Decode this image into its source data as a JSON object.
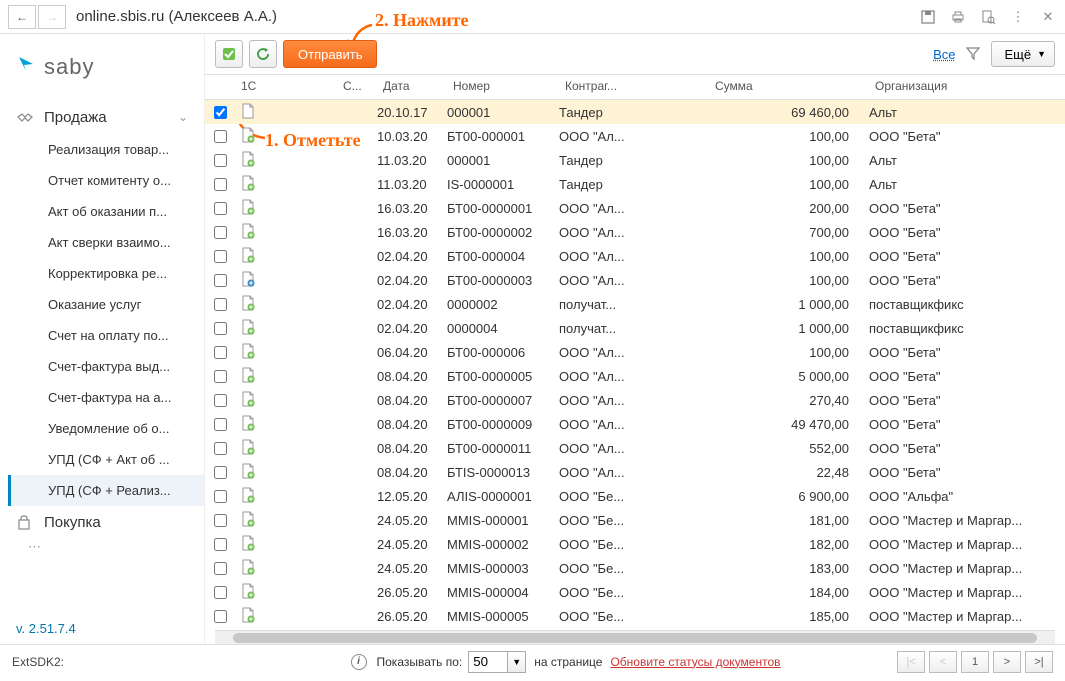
{
  "titlebar": {
    "title": "online.sbis.ru (Алексеев А.А.)"
  },
  "annotations": {
    "step1": "1. Отметьте",
    "step2": "2. Нажмите"
  },
  "logo": "saby",
  "sidebar": {
    "section1": {
      "label": "Продажа"
    },
    "items": [
      "Реализация товар...",
      "Отчет комитенту о...",
      "Акт об оказании п...",
      "Акт сверки взаимо...",
      "Корректировка ре...",
      "Оказание услуг",
      "Счет на оплату по...",
      "Счет-фактура выд...",
      "Счет-фактура на а...",
      "Уведомление об о...",
      "УПД (СФ + Акт об ...",
      "УПД (СФ + Реализ..."
    ],
    "section2": {
      "label": "Покупка"
    }
  },
  "version": "v. 2.51.7.4",
  "toolbar": {
    "send": "Отправить",
    "all": "Все",
    "more": "Ещё"
  },
  "columns": {
    "c1": "1С",
    "c2": "С...",
    "c3": "Дата",
    "c4": "Номер",
    "c5": "Контраг...",
    "c6": "Сумма",
    "c7": "Организация"
  },
  "rows": [
    {
      "checked": true,
      "iconColor": "#d0d0d0",
      "date": "20.10.17",
      "num": "000001",
      "contr": "Тандер",
      "sum": "69 460,00",
      "org": "Альт"
    },
    {
      "checked": false,
      "iconColor": "#6fbf4b",
      "date": "10.03.20",
      "num": "БТ00-000001",
      "contr": "ООО \"Ал...",
      "sum": "100,00",
      "org": "ООО \"Бета\""
    },
    {
      "checked": false,
      "iconColor": "#6fbf4b",
      "date": "11.03.20",
      "num": "000001",
      "contr": "Тандер",
      "sum": "100,00",
      "org": "Альт"
    },
    {
      "checked": false,
      "iconColor": "#6fbf4b",
      "date": "11.03.20",
      "num": "IS-0000001",
      "contr": "Тандер",
      "sum": "100,00",
      "org": "Альт"
    },
    {
      "checked": false,
      "iconColor": "#6fbf4b",
      "date": "16.03.20",
      "num": "БТ00-0000001",
      "contr": "ООО \"Ал...",
      "sum": "200,00",
      "org": "ООО \"Бета\""
    },
    {
      "checked": false,
      "iconColor": "#6fbf4b",
      "date": "16.03.20",
      "num": "БТ00-0000002",
      "contr": "ООО \"Ал...",
      "sum": "700,00",
      "org": "ООО \"Бета\""
    },
    {
      "checked": false,
      "iconColor": "#6fbf4b",
      "date": "02.04.20",
      "num": "БТ00-000004",
      "contr": "ООО \"Ал...",
      "sum": "100,00",
      "org": "ООО \"Бета\""
    },
    {
      "checked": false,
      "iconColor": "#3a8ac9",
      "date": "02.04.20",
      "num": "БТ00-0000003",
      "contr": "ООО \"Ал...",
      "sum": "100,00",
      "org": "ООО \"Бета\""
    },
    {
      "checked": false,
      "iconColor": "#6fbf4b",
      "date": "02.04.20",
      "num": "0000002",
      "contr": "получат...",
      "sum": "1 000,00",
      "org": "поставщикфикс"
    },
    {
      "checked": false,
      "iconColor": "#6fbf4b",
      "date": "02.04.20",
      "num": "0000004",
      "contr": "получат...",
      "sum": "1 000,00",
      "org": "поставщикфикс"
    },
    {
      "checked": false,
      "iconColor": "#6fbf4b",
      "date": "06.04.20",
      "num": "БТ00-000006",
      "contr": "ООО \"Ал...",
      "sum": "100,00",
      "org": "ООО \"Бета\""
    },
    {
      "checked": false,
      "iconColor": "#6fbf4b",
      "date": "08.04.20",
      "num": "БТ00-0000005",
      "contr": "ООО \"Ал...",
      "sum": "5 000,00",
      "org": "ООО \"Бета\""
    },
    {
      "checked": false,
      "iconColor": "#6fbf4b",
      "date": "08.04.20",
      "num": "БТ00-0000007",
      "contr": "ООО \"Ал...",
      "sum": "270,40",
      "org": "ООО \"Бета\""
    },
    {
      "checked": false,
      "iconColor": "#6fbf4b",
      "date": "08.04.20",
      "num": "БТ00-0000009",
      "contr": "ООО \"Ал...",
      "sum": "49 470,00",
      "org": "ООО \"Бета\""
    },
    {
      "checked": false,
      "iconColor": "#6fbf4b",
      "date": "08.04.20",
      "num": "БТ00-0000011",
      "contr": "ООО \"Ал...",
      "sum": "552,00",
      "org": "ООО \"Бета\""
    },
    {
      "checked": false,
      "iconColor": "#6fbf4b",
      "date": "08.04.20",
      "num": "БТIS-0000013",
      "contr": "ООО \"Ал...",
      "sum": "22,48",
      "org": "ООО \"Бета\""
    },
    {
      "checked": false,
      "iconColor": "#6fbf4b",
      "date": "12.05.20",
      "num": "АЛIS-0000001",
      "contr": "ООО \"Бе...",
      "sum": "6 900,00",
      "org": "ООО \"Альфа\""
    },
    {
      "checked": false,
      "iconColor": "#6fbf4b",
      "date": "24.05.20",
      "num": "ММIS-000001",
      "contr": "ООО \"Бе...",
      "sum": "181,00",
      "org": "ООО \"Мастер и Маргар..."
    },
    {
      "checked": false,
      "iconColor": "#6fbf4b",
      "date": "24.05.20",
      "num": "ММIS-000002",
      "contr": "ООО \"Бе...",
      "sum": "182,00",
      "org": "ООО \"Мастер и Маргар..."
    },
    {
      "checked": false,
      "iconColor": "#6fbf4b",
      "date": "24.05.20",
      "num": "ММIS-000003",
      "contr": "ООО \"Бе...",
      "sum": "183,00",
      "org": "ООО \"Мастер и Маргар..."
    },
    {
      "checked": false,
      "iconColor": "#6fbf4b",
      "date": "26.05.20",
      "num": "ММIS-000004",
      "contr": "ООО \"Бе...",
      "sum": "184,00",
      "org": "ООО \"Мастер и Маргар..."
    },
    {
      "checked": false,
      "iconColor": "#6fbf4b",
      "date": "26.05.20",
      "num": "ММIS-000005",
      "contr": "ООО \"Бе...",
      "sum": "185,00",
      "org": "ООО \"Мастер и Маргар..."
    }
  ],
  "footer": {
    "extsdk": "ExtSDK2:",
    "perPageLabel": "Показывать по:",
    "perPageValue": "50",
    "onPage": "на странице",
    "updateLink": "Обновите статусы документов",
    "pageCurrent": "1"
  }
}
